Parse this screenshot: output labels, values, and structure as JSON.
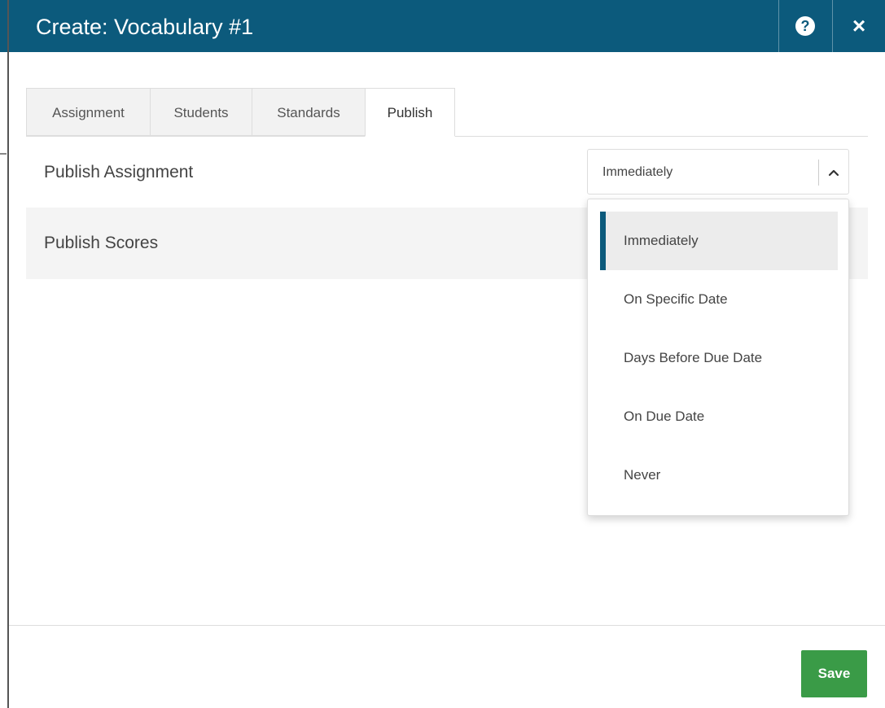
{
  "window": {
    "title": "Create: Vocabulary #1",
    "help_label": "?",
    "close_label": "×"
  },
  "tabs": [
    {
      "label": "Assignment",
      "active": false
    },
    {
      "label": "Students",
      "active": false
    },
    {
      "label": "Standards",
      "active": false
    },
    {
      "label": "Publish",
      "active": true
    }
  ],
  "publish": {
    "assignment_label": "Publish Assignment",
    "scores_label": "Publish Scores",
    "selected_value": "Immediately",
    "options": [
      {
        "label": "Immediately",
        "selected": true
      },
      {
        "label": "On Specific Date",
        "selected": false
      },
      {
        "label": "Days Before Due Date",
        "selected": false
      },
      {
        "label": "On Due Date",
        "selected": false
      },
      {
        "label": "Never",
        "selected": false
      }
    ]
  },
  "footer": {
    "save_label": "Save"
  },
  "colors": {
    "header": "#0c5a7c",
    "save": "#3a9b47",
    "selected_accent": "#0c5a7c"
  },
  "icons": [
    "help-icon",
    "close-icon",
    "chevron-up-icon"
  ]
}
